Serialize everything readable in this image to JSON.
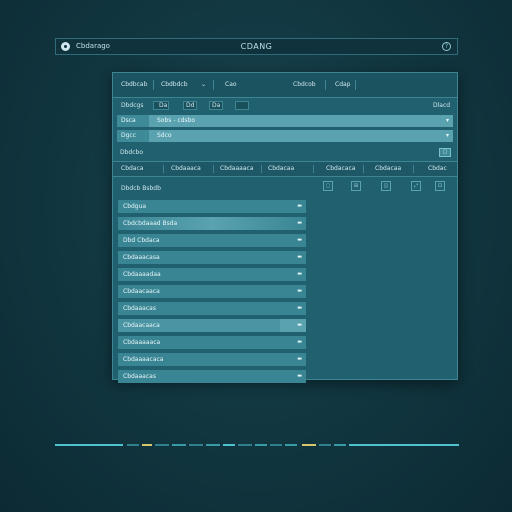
{
  "topbar": {
    "app_name": "Cbdarago",
    "title": "CDANG",
    "icons": [
      "app-logo-icon",
      "help-icon"
    ]
  },
  "panel": {
    "row1": {
      "cells": [
        "Cbdbcab",
        "Cbdbdcb",
        "Cao",
        "Cbdcob",
        "Cdap"
      ]
    },
    "row2": {
      "cells": [
        "Dbdcgs",
        "Da",
        "Dd",
        "Da",
        "Dlacd"
      ]
    },
    "fields": [
      {
        "label": "Dsca",
        "value": "Sobs - cdsbo"
      },
      {
        "label": "Dgcc",
        "value": "Sdco"
      }
    ],
    "row5": {
      "label": "Dbdcbo",
      "button": "▢"
    },
    "column_headers": [
      "Cbdaca",
      "Cbdaaaca",
      "Cbdaaaaca",
      "Cbdacaa",
      "Cbdacaca",
      "Cbdacaa",
      "Cbdac"
    ],
    "section_title": "Dbdcb Bsbdb",
    "tools": [
      "▢",
      "⊞",
      "◫",
      "⤢",
      "⊡"
    ],
    "list_items": [
      "Cbdgua",
      "Cbdcbdaaad Bsda",
      "Dbd Cbdaca",
      "Cbdaaacasa",
      "Cbdaaaadaa",
      "Cbdaacaaca",
      "Cbdaaacas",
      "Cbdaacaaca",
      "Cbdaaaaaca",
      "Cbdaaaacaca",
      "Cbdaaacas"
    ]
  },
  "colors": {
    "accent": "#5aa2b0",
    "panel": "#21606e",
    "bar_cyan": "#4fc1cf",
    "bar_yellow": "#d9c56a"
  }
}
